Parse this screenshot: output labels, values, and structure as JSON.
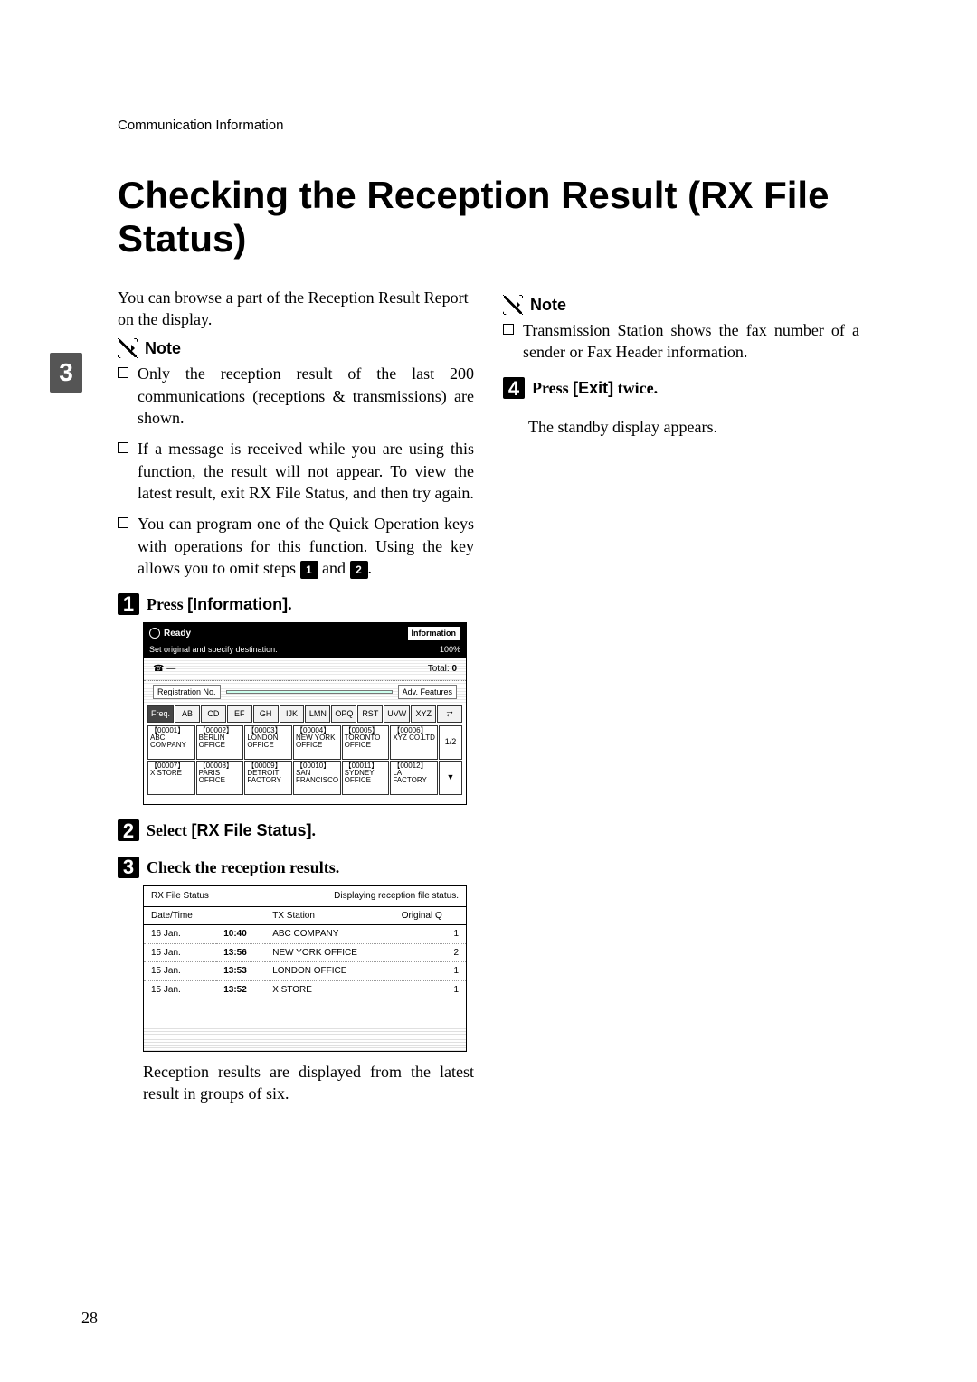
{
  "running_head": "Communication Information",
  "title": "Checking the Reception Result (RX File Status)",
  "tab_number": "3",
  "page_number": "28",
  "left": {
    "lead": "You can browse a part of the Reception Result Report on the display.",
    "note_label": "Note",
    "notes": [
      "Only the reception result of the last 200 communications (receptions & transmissions) are shown.",
      "If a message is received while you are using this function, the result will not appear. To view the latest result, exit RX File Status, and then try again.",
      "You can program one of the Quick Operation keys with operations for this function. Using the key allows you to omit steps"
    ],
    "omit_steps_suffix": " and ",
    "omit_steps_end": ".",
    "steps": {
      "s1": {
        "num": "1",
        "prefix": "Press ",
        "ui": "[Information]",
        "suffix": "."
      },
      "s2": {
        "num": "2",
        "prefix": "Select ",
        "ui": "[RX File Status]",
        "suffix": "."
      },
      "s3": {
        "num": "3",
        "text": "Check the reception results."
      }
    },
    "after_ss2": "Reception results are displayed from the latest result in groups of six."
  },
  "right": {
    "note_label": "Note",
    "note_item": "Transmission Station shows the fax number of a sender or Fax Header information.",
    "step4": {
      "num": "4",
      "prefix": "Press ",
      "ui": "[Exit]",
      "suffix": " twice."
    },
    "after_step4": "The standby display appears."
  },
  "ss1": {
    "ready": "Ready",
    "info_btn": "Information",
    "sub": "Set original and specify destination.",
    "pct": "100%",
    "total_lbl": "Total:",
    "total_val": "0",
    "reg_lbl": "Registration No.",
    "adv": "Adv. Features",
    "tabs": [
      "Freq.",
      "AB",
      "CD",
      "EF",
      "GH",
      "IJK",
      "LMN",
      "OPQ",
      "RST",
      "UVW",
      "XYZ"
    ],
    "page": "1/2",
    "cells_row1": [
      {
        "id": "【00001】",
        "name": "ABC COMPANY"
      },
      {
        "id": "【00002】",
        "name": "BERLIN OFFICE"
      },
      {
        "id": "【00003】",
        "name": "LONDON OFFICE"
      },
      {
        "id": "【00004】",
        "name": "NEW YORK OFFICE"
      },
      {
        "id": "【00005】",
        "name": "TORONTO OFFICE"
      },
      {
        "id": "【00006】",
        "name": "XYZ CO.LTD"
      }
    ],
    "cells_row2": [
      {
        "id": "【00007】",
        "name": "X STORE"
      },
      {
        "id": "【00008】",
        "name": "PARIS OFFICE"
      },
      {
        "id": "【00009】",
        "name": "DETROIT FACTORY"
      },
      {
        "id": "【00010】",
        "name": "SAN FRANCISCO"
      },
      {
        "id": "【00011】",
        "name": "SYDNEY OFFICE"
      },
      {
        "id": "【00012】",
        "name": "LA FACTORY"
      }
    ]
  },
  "ss2": {
    "title": "RX File Status",
    "subtitle": "Displaying reception file status.",
    "col_datetime": "Date/Time",
    "col_tx": "TX Station",
    "col_orig": "Original Q",
    "rows": [
      {
        "date": "16 Jan.",
        "time": "10:40",
        "tx": "ABC COMPANY",
        "q": "1"
      },
      {
        "date": "15 Jan.",
        "time": "13:56",
        "tx": "NEW YORK OFFICE",
        "q": "2"
      },
      {
        "date": "15 Jan.",
        "time": "13:53",
        "tx": "LONDON OFFICE",
        "q": "1"
      },
      {
        "date": "15 Jan.",
        "time": "13:52",
        "tx": "X STORE",
        "q": "1"
      }
    ]
  }
}
